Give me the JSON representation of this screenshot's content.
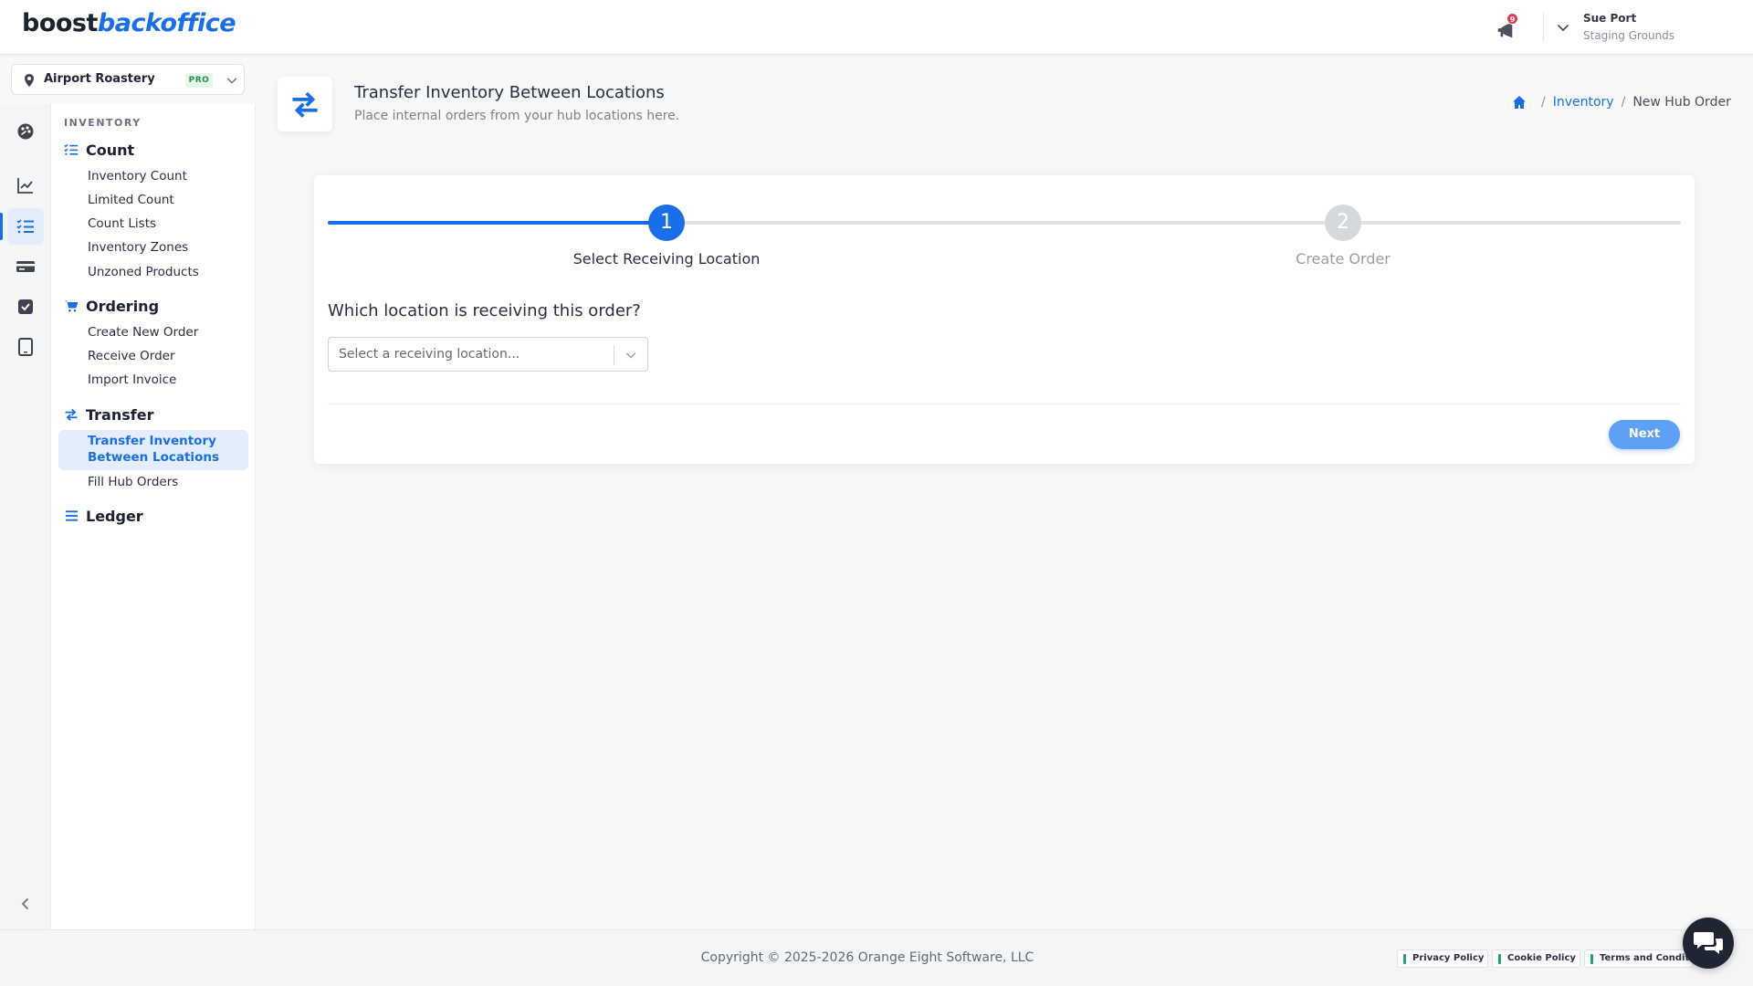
{
  "brand": {
    "part1": "boost",
    "part2": "backoffice"
  },
  "topbar": {
    "notification_count": "9",
    "user_name": "Sue Port",
    "user_location": "Staging Grounds"
  },
  "location_selector": {
    "name": "Airport Roastery",
    "badge": "PRO"
  },
  "sidebar": {
    "section_title": "INVENTORY",
    "groups": [
      {
        "title": "Count",
        "items": [
          "Inventory Count",
          "Limited Count",
          "Count Lists",
          "Inventory Zones",
          "Unzoned Products"
        ]
      },
      {
        "title": "Ordering",
        "items": [
          "Create New Order",
          "Receive Order",
          "Import Invoice"
        ]
      },
      {
        "title": "Transfer",
        "active_item": "Transfer Inventory Between Locations",
        "active_item_lines": [
          "Transfer Inventory",
          "Between Locations"
        ],
        "items": [
          "Fill Hub Orders"
        ]
      },
      {
        "title": "Ledger",
        "items": []
      }
    ]
  },
  "page": {
    "title": "Transfer Inventory Between Locations",
    "subtitle": "Place internal orders from your hub locations here."
  },
  "breadcrumb": {
    "link": "Inventory",
    "current": "New Hub Order"
  },
  "wizard": {
    "steps": [
      {
        "number": "1",
        "label": "Select Receiving Location",
        "active": true
      },
      {
        "number": "2",
        "label": "Create Order",
        "active": false
      }
    ],
    "question": "Which location is receiving this order?",
    "select_placeholder": "Select a receiving location...",
    "next_label": "Next"
  },
  "footer": {
    "copyright": "Copyright © 2025-2026 Orange Eight Software, LLC",
    "links": [
      "Privacy Policy",
      "Cookie Policy",
      "Terms and Conditions"
    ]
  },
  "colors": {
    "accent": "#1a6fe8",
    "badge": "#e8384f",
    "pro_green": "#2c8a4b",
    "next_button": "#5da0f5"
  },
  "icons": [
    "megaphone-icon",
    "chevron-down-icon",
    "map-pin-icon",
    "palette-icon",
    "chart-line-icon",
    "list-check-icon",
    "card-icon",
    "checkbox-icon",
    "tablet-icon",
    "chevron-left-icon",
    "cart-icon",
    "transfer-arrows-icon",
    "list-icon",
    "home-icon",
    "chat-icon"
  ]
}
